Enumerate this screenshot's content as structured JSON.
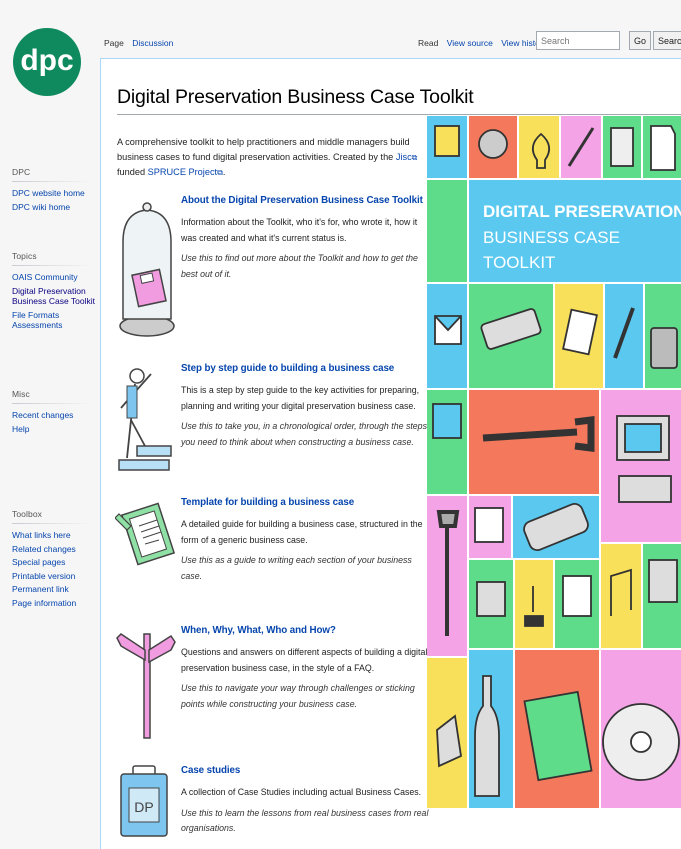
{
  "logo": {
    "text": "dpc",
    "color": "#0f8a5f"
  },
  "sidebar": {
    "sections": [
      {
        "heading": "DPC",
        "links": [
          "DPC website home",
          "DPC wiki home"
        ]
      },
      {
        "heading": "Topics",
        "links": [
          "OAIS Community",
          "Digital Preservation Business Case Toolkit",
          "File Formats Assessments"
        ]
      },
      {
        "heading": "Misc",
        "links": [
          "Recent changes",
          "Help"
        ]
      },
      {
        "heading": "Toolbox",
        "links": [
          "What links here",
          "Related changes",
          "Special pages",
          "Printable version",
          "Permanent link",
          "Page information"
        ]
      }
    ]
  },
  "tabs": {
    "page": "Page",
    "discussion": "Discussion",
    "read": "Read",
    "view_source": "View source",
    "view_history": "View history"
  },
  "search": {
    "placeholder": "Search",
    "go": "Go",
    "search": "Search"
  },
  "content": {
    "title": "Digital Preservation Business Case Toolkit",
    "intro_prefix": "A comprehensive toolkit to help practitioners and middle managers build business cases to fund digital preservation activities. Created by the ",
    "intro_link1": "Jisc",
    "intro_middle": " funded ",
    "intro_link2": "SPRUCE Project",
    "intro_suffix": ".",
    "entries": [
      {
        "title": "About the Digital Preservation Business Case Toolkit",
        "desc": "Information about the Toolkit, who it's for, who wrote it, how it was created and what it's current status is.",
        "use": "Use this to find out more about the Toolkit and how to get the best out of it."
      },
      {
        "title": "Step by step guide to building a business case",
        "desc": "This is a step by step guide to the key activities for preparing, planning and writing your digital preservation business case.",
        "use": "Use this to take you, in a chronological order, through the steps you need to think about when constructing a business case."
      },
      {
        "title": "Template for building a business case",
        "desc": "A detailed guide for building a business case, structured in the form of a generic business case.",
        "use": "Use this as a guide to writing each section of your business case."
      },
      {
        "title": "When, Why, What, Who and How?",
        "desc": "Questions and answers on different aspects of building a digital preservation business case, in the style of a FAQ.",
        "use": "Use this to navigate your way through challenges or sticking points while constructing your business case."
      },
      {
        "title": "Case studies",
        "desc": "A collection of Case Studies including actual Business Cases.",
        "use": "Use this to learn the lessons from real business cases from real organisations."
      }
    ]
  },
  "poster": {
    "line1": "DIGITAL PRESERVATION",
    "line2": "BUSINESS CASE",
    "line3": "TOOLKIT",
    "colors": {
      "blue": "#5bc8f0",
      "green": "#5fdc8a",
      "yellow": "#f8e05a",
      "pink": "#f3a3e6",
      "orange": "#f4795c",
      "lightblue": "#8fd3f0"
    }
  }
}
